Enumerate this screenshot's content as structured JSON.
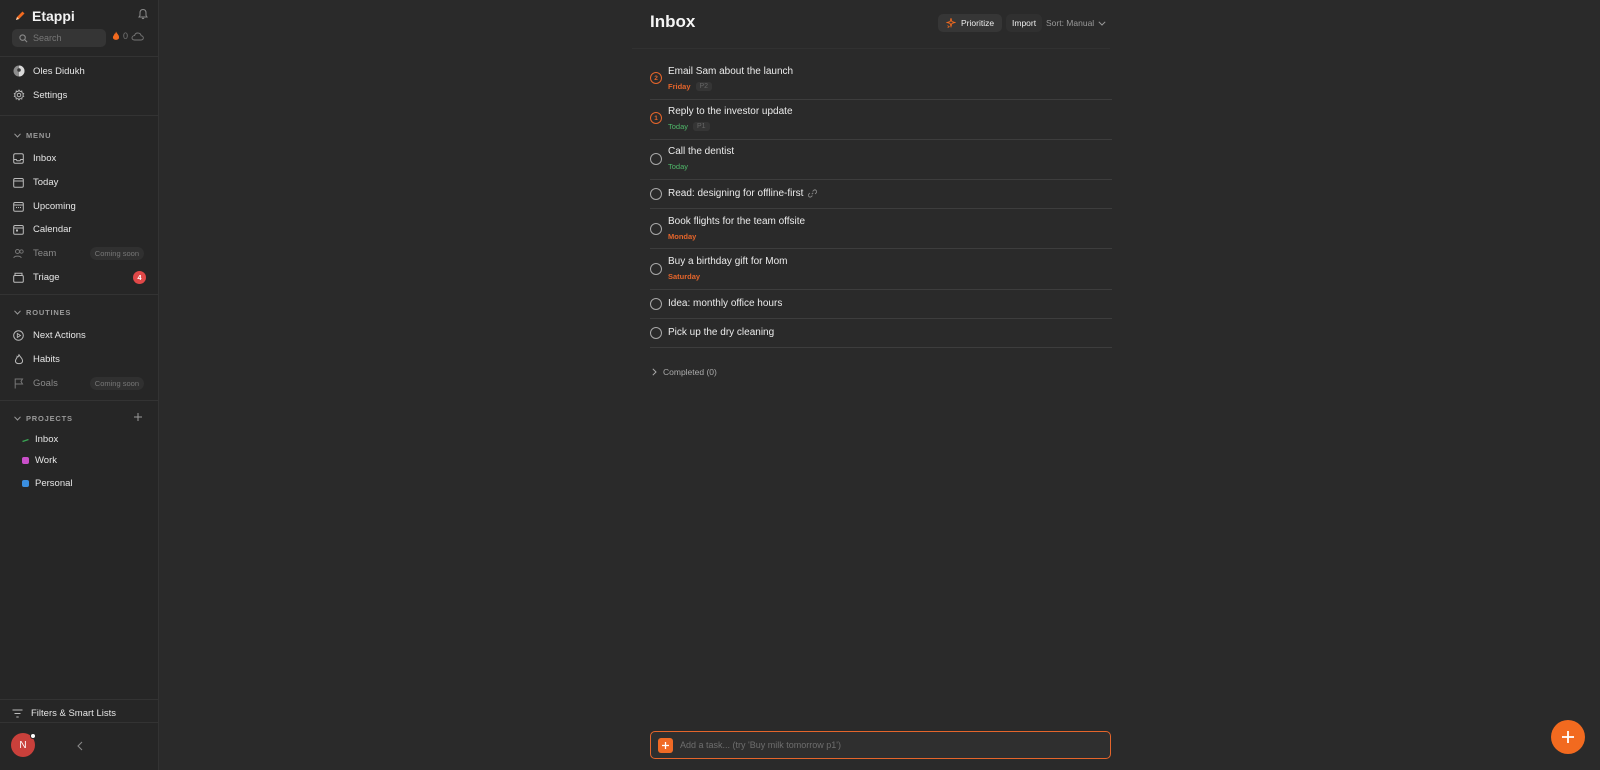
{
  "app": {
    "name": "Etappi",
    "streak_count": "0"
  },
  "search": {
    "placeholder": "Search"
  },
  "account": {
    "user_name": "Oles Didukh",
    "settings_label": "Settings"
  },
  "menu": {
    "header": "MENU",
    "items": [
      {
        "label": "Inbox",
        "icon": "inbox-icon"
      },
      {
        "label": "Today",
        "icon": "calendar-day-icon"
      },
      {
        "label": "Upcoming",
        "icon": "calendar-upcoming-icon"
      },
      {
        "label": "Calendar",
        "icon": "calendar-icon"
      },
      {
        "label": "Team",
        "icon": "team-icon",
        "tag": "Coming soon"
      },
      {
        "label": "Triage",
        "icon": "tray-icon",
        "badge": "4"
      }
    ]
  },
  "routines": {
    "header": "ROUTINES",
    "items": [
      {
        "label": "Next Actions",
        "icon": "play-circle-icon"
      },
      {
        "label": "Habits",
        "icon": "flame-icon"
      },
      {
        "label": "Goals",
        "icon": "flag-icon",
        "tag": "Coming soon"
      }
    ]
  },
  "projects": {
    "header": "PROJECTS",
    "items": [
      {
        "label": "Inbox",
        "color": "#3aa655"
      },
      {
        "label": "Work",
        "color": "#c94fc9"
      },
      {
        "label": "Personal",
        "color": "#3a8ee0"
      }
    ]
  },
  "footer": {
    "filters_label": "Filters & Smart Lists",
    "avatar_initial": "N"
  },
  "header": {
    "title": "Inbox",
    "prioritize_label": "Prioritize",
    "import_label": "Import",
    "sort_label": "Sort: Manual"
  },
  "tasks": [
    {
      "title": "Email Sam about the launch",
      "due": "Friday",
      "priority": "P2",
      "marker": "2"
    },
    {
      "title": "Reply to the investor update",
      "due": "Today",
      "priority": "P1",
      "marker": "1"
    },
    {
      "title": "Call the dentist",
      "due": "Today"
    },
    {
      "title": "Read: designing for offline-first"
    },
    {
      "title": "Book flights for the team offsite",
      "due": "Monday"
    },
    {
      "title": "Buy a birthday gift for Mom",
      "due": "Saturday"
    },
    {
      "title": "Idea: monthly office hours"
    },
    {
      "title": "Pick up the dry cleaning"
    }
  ],
  "completed": {
    "label": "Completed (0)"
  },
  "add_task": {
    "placeholder": "Add a task... (try 'Buy milk tomorrow p1')"
  },
  "colors": {
    "accent": "#f26a1f",
    "today": "#4fb86a",
    "badge": "#e04848"
  }
}
